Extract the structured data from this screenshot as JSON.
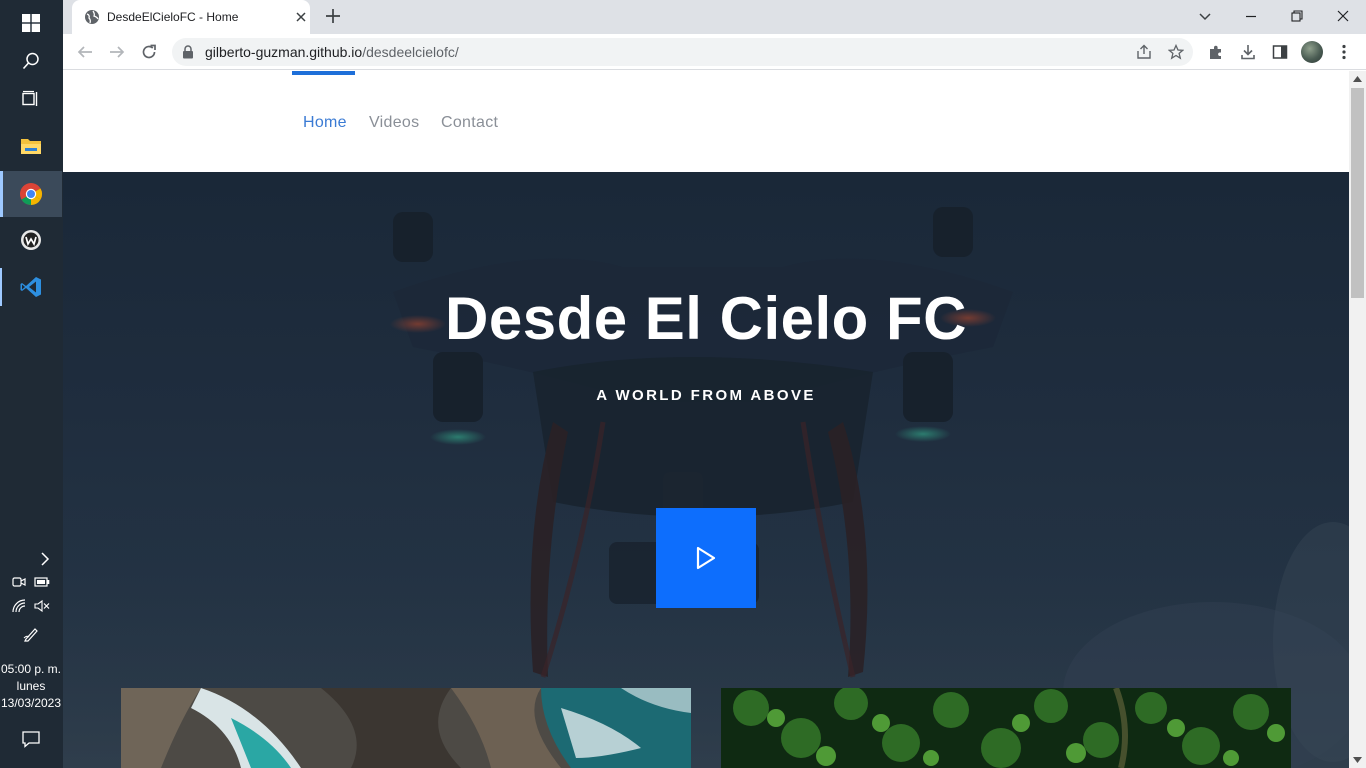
{
  "taskbar": {
    "icons": [
      "windows-start-icon",
      "search-icon",
      "task-view-icon",
      "file-explorer-icon",
      "chrome-icon",
      "app-w-icon",
      "vscode-icon"
    ],
    "tray_icons": [
      "chevron-right-icon",
      "meet-now-icon",
      "battery-icon",
      "network-icon",
      "volume-muted-icon",
      "pen-icon",
      "notification-icon"
    ],
    "clock": {
      "time": "05:00 p. m.",
      "day": "lunes",
      "date": "13/03/2023"
    }
  },
  "browser": {
    "tab": {
      "title": "DesdeElCieloFC - Home",
      "favicon": "globe-icon"
    },
    "address": {
      "host": "gilberto-guzman.github.io",
      "path": "/desdeelcielofc/"
    }
  },
  "site": {
    "nav": [
      {
        "label": "Home",
        "active": true
      },
      {
        "label": "Videos",
        "active": false
      },
      {
        "label": "Contact",
        "active": false
      }
    ],
    "hero": {
      "title": "Desde El Cielo FC",
      "subtitle": "A WORLD FROM ABOVE",
      "play_icon": "play-icon"
    }
  },
  "colors": {
    "accent": "#0d6efd",
    "nav_active": "#3b7bd4",
    "hero_bg": "#1f2d3e",
    "taskbar_bg": "#1f2a35"
  }
}
